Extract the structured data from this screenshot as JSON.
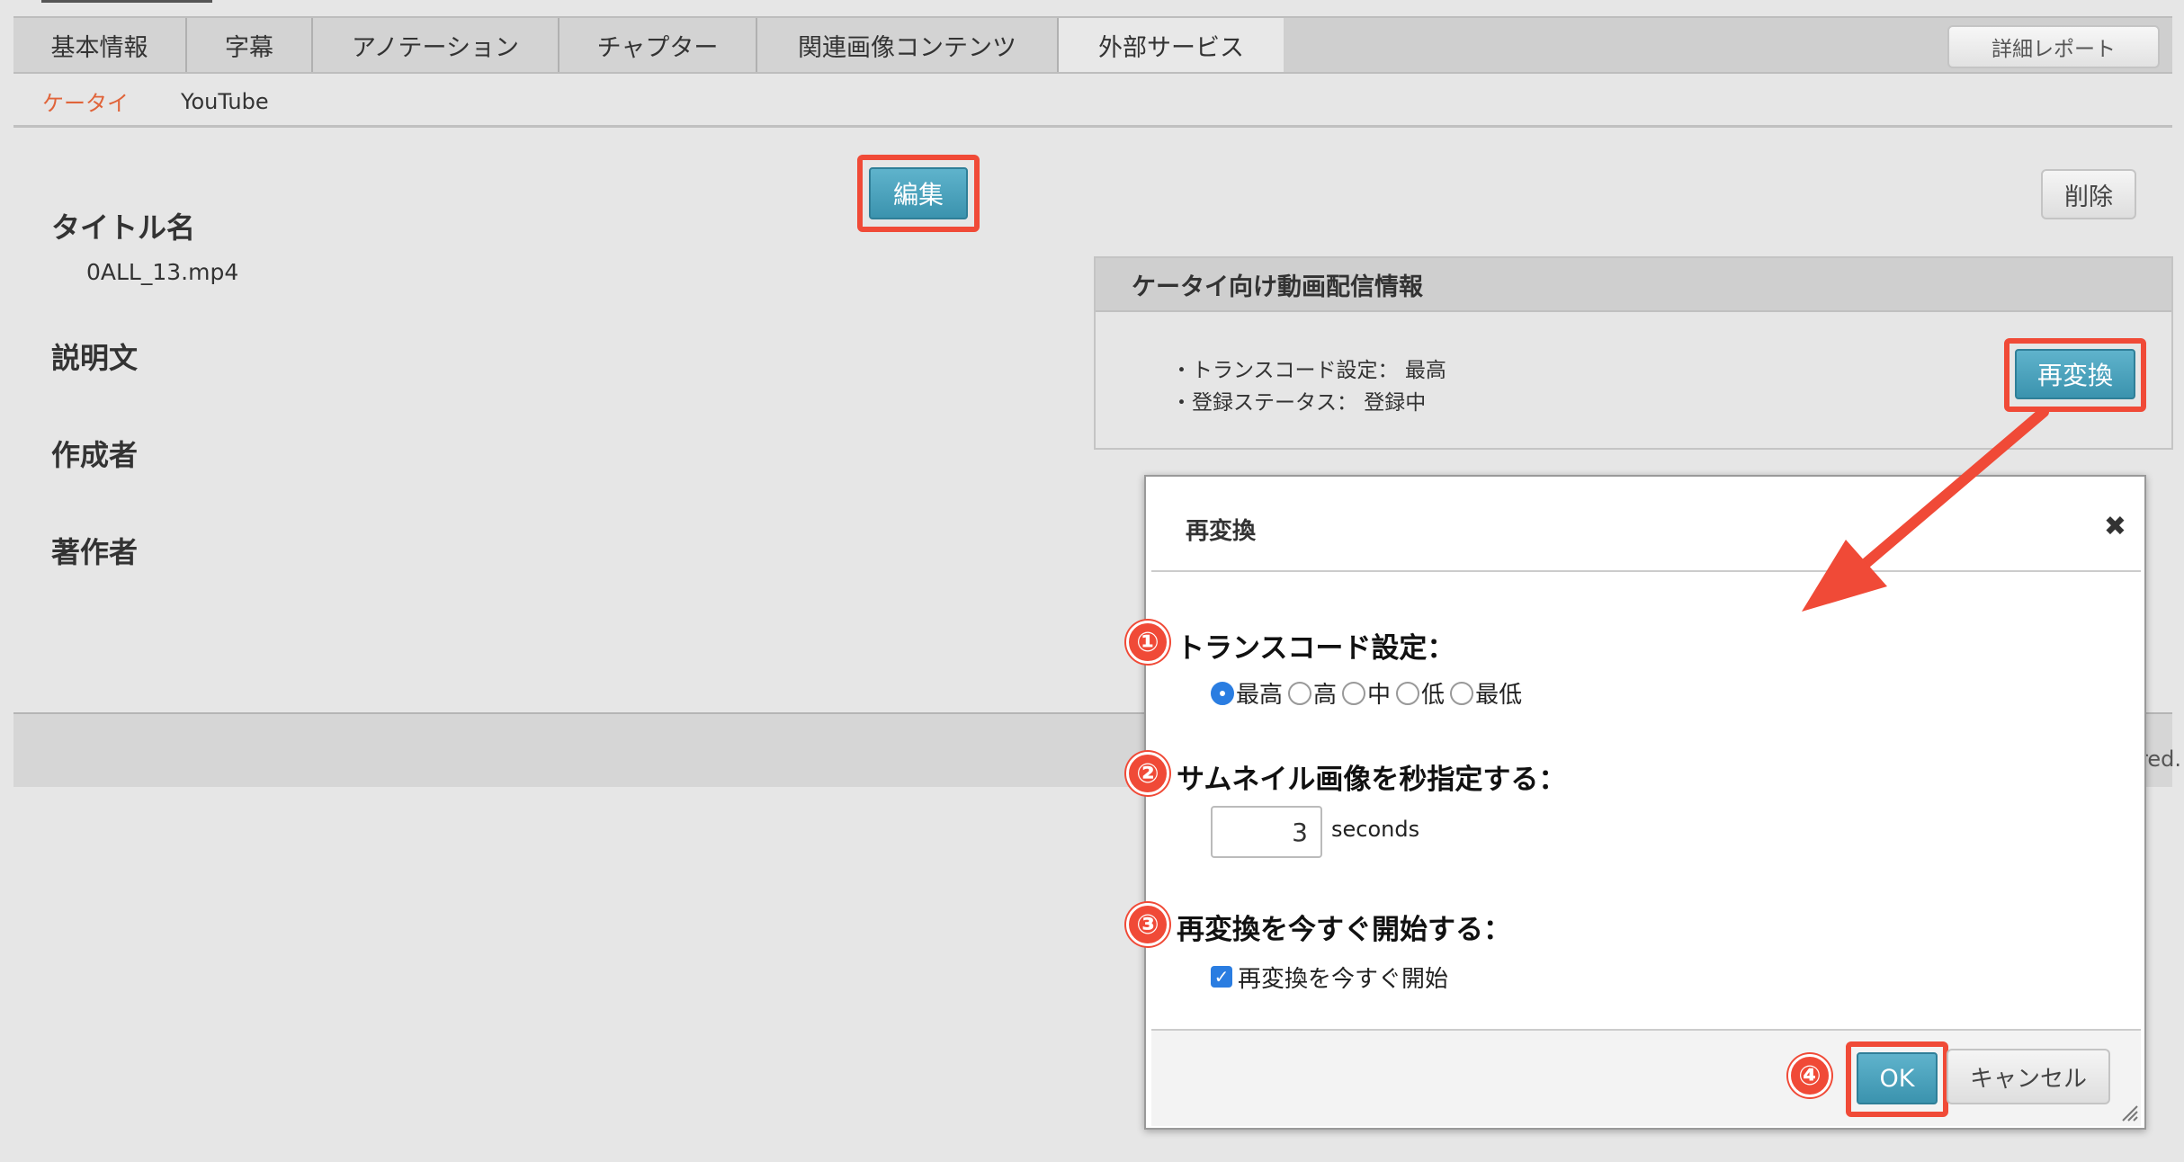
{
  "tabs": [
    {
      "label": "基本情報"
    },
    {
      "label": "字幕"
    },
    {
      "label": "アノテーション"
    },
    {
      "label": "チャプター"
    },
    {
      "label": "関連画像コンテンツ"
    },
    {
      "label": "外部サービス"
    }
  ],
  "report_button": "詳細レポート",
  "subtabs": [
    {
      "label": "ケータイ"
    },
    {
      "label": "YouTube"
    }
  ],
  "edit_button": "編集",
  "delete_button": "削除",
  "fields": {
    "title_label": "タイトル名",
    "title_value": "0ALL_13.mp4",
    "description_label": "説明文",
    "creator_label": "作成者",
    "author_label": "著作者"
  },
  "panel": {
    "heading": "ケータイ向け動画配信情報",
    "transcode_line": "・トランスコード設定： 最高",
    "status_line": "・登録ステータス： 登録中",
    "reconvert_button": "再変換"
  },
  "footer_text": "red.",
  "dialog": {
    "title": "再変換",
    "close": "✖",
    "section1": {
      "badge": "①",
      "title": "トランスコード設定：",
      "options": [
        "最高",
        "高",
        "中",
        "低",
        "最低"
      ],
      "selected": "最高"
    },
    "section2": {
      "badge": "②",
      "title": "サムネイル画像を秒指定する：",
      "value": "3",
      "unit": "seconds"
    },
    "section3": {
      "badge": "③",
      "title": "再変換を今すぐ開始する：",
      "checkbox_label": "再変換を今すぐ開始",
      "checked": true
    },
    "ok_badge": "④",
    "ok_button": "OK",
    "cancel_button": "キャンセル"
  },
  "colors": {
    "highlight": "#f04a37",
    "button_blue": "#3b93ae",
    "active_subtab": "#e0643a"
  }
}
